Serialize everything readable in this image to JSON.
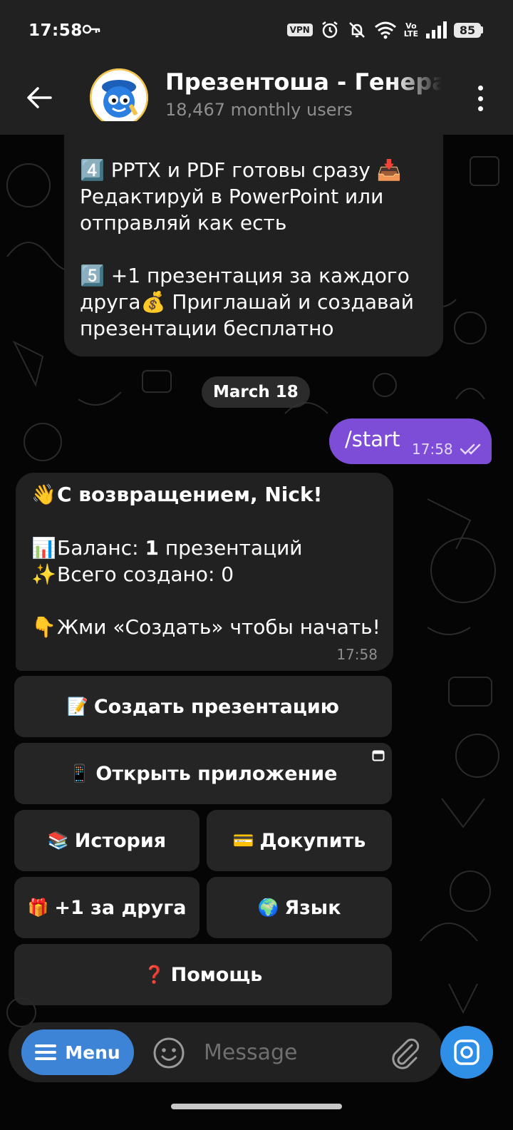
{
  "status_bar": {
    "time": "17:58",
    "vpn": "VPN",
    "volte": "Vo\nLTE",
    "battery": "85"
  },
  "header": {
    "title": "Презентоша - Генератор презентаций",
    "subtitle": "18,467 monthly users"
  },
  "messages": [
    {
      "type": "incoming",
      "text": "4️⃣ PPTX и PDF готовы сразу 📥\nРедактируй в PowerPoint или\nотправляй как есть\n\n5️⃣ +1 презентация за каждого\nдруга💰 Приглашай и создавай\nпрезентации бесплатно"
    }
  ],
  "date_chip": "March 18",
  "outgoing": {
    "text": "/start",
    "time": "17:58"
  },
  "reply": {
    "greeting": "С возвращением, Nick!",
    "greeting_emoji": "👋",
    "balance_emoji": "📊",
    "balance_label": "Баланс: ",
    "balance_value": "1",
    "balance_unit": " презентаций",
    "total_emoji": "✨",
    "total_text": "Всего создано: 0",
    "cta_emoji": "👇",
    "cta_text": "Жми «Создать» чтобы начать!",
    "time": "17:58"
  },
  "keyboard": {
    "create": {
      "icon": "📝",
      "label": "Создать презентацию"
    },
    "app": {
      "icon": "📱",
      "label": "Открыть приложение"
    },
    "history": {
      "icon": "📚",
      "label": "История"
    },
    "buy": {
      "icon": "💳",
      "label": "Докупить"
    },
    "friend": {
      "icon": "🎁",
      "label": "+1 за друга"
    },
    "language": {
      "icon": "🌍",
      "label": "Язык"
    },
    "help": {
      "icon": "❓",
      "label": "Помощь"
    }
  },
  "input_bar": {
    "menu_label": "Menu",
    "placeholder": "Message"
  },
  "colors": {
    "outgoing_bubble": "#7d4dd8",
    "menu_button": "#3e84d6",
    "camera_button": "#2f8ee5"
  }
}
